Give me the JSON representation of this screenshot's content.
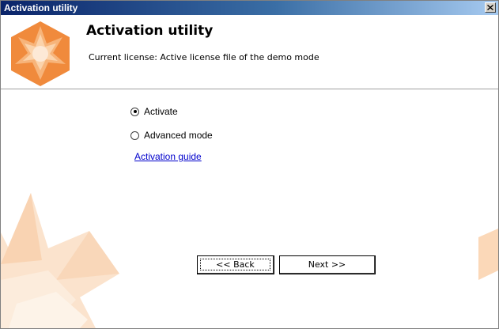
{
  "window": {
    "title": "Activation utility",
    "close_icon": "close-icon"
  },
  "header": {
    "title": "Activation utility",
    "license_text": "Current license: Active license file of the demo mode",
    "logo_icon": "hexagon-star-logo"
  },
  "options": {
    "activate_label": "Activate",
    "activate_selected": true,
    "advanced_label": "Advanced mode",
    "advanced_selected": false,
    "guide_link": "Activation guide"
  },
  "buttons": {
    "back_label": "<< Back",
    "next_label": "Next >>"
  },
  "colors": {
    "accent_orange": "#f08a3c",
    "accent_light": "#fbd8b8",
    "link": "#0000cc"
  }
}
